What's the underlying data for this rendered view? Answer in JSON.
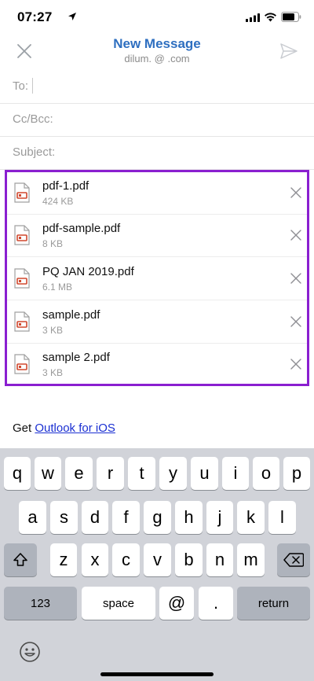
{
  "status_bar": {
    "time": "07:27"
  },
  "header": {
    "title": "New Message",
    "account": "dilum.                 @     .com"
  },
  "fields": {
    "to_label": "To:",
    "cc_label": "Cc/Bcc:",
    "subject_label": "Subject:"
  },
  "attachments": [
    {
      "name": "pdf-1.pdf",
      "size": "424 KB"
    },
    {
      "name": "pdf-sample.pdf",
      "size": "8 KB"
    },
    {
      "name": "PQ JAN 2019.pdf",
      "size": "6.1 MB"
    },
    {
      "name": "sample.pdf",
      "size": "3 KB"
    },
    {
      "name": "sample 2.pdf",
      "size": "3 KB"
    }
  ],
  "signature": {
    "prefix": "Get ",
    "link": "Outlook for iOS"
  },
  "keyboard": {
    "row1": [
      "q",
      "w",
      "e",
      "r",
      "t",
      "y",
      "u",
      "i",
      "o",
      "p"
    ],
    "row2": [
      "a",
      "s",
      "d",
      "f",
      "g",
      "h",
      "j",
      "k",
      "l"
    ],
    "row3": [
      "z",
      "x",
      "c",
      "v",
      "b",
      "n",
      "m"
    ],
    "numbers_label": "123",
    "space_label": "space",
    "at_label": "@",
    "dot_label": ".",
    "return_label": "return"
  },
  "colors": {
    "title": "#2e6fc0",
    "highlight_border": "#8a1fd0",
    "link": "#1a2fd2",
    "pdf_red": "#d0482e"
  }
}
